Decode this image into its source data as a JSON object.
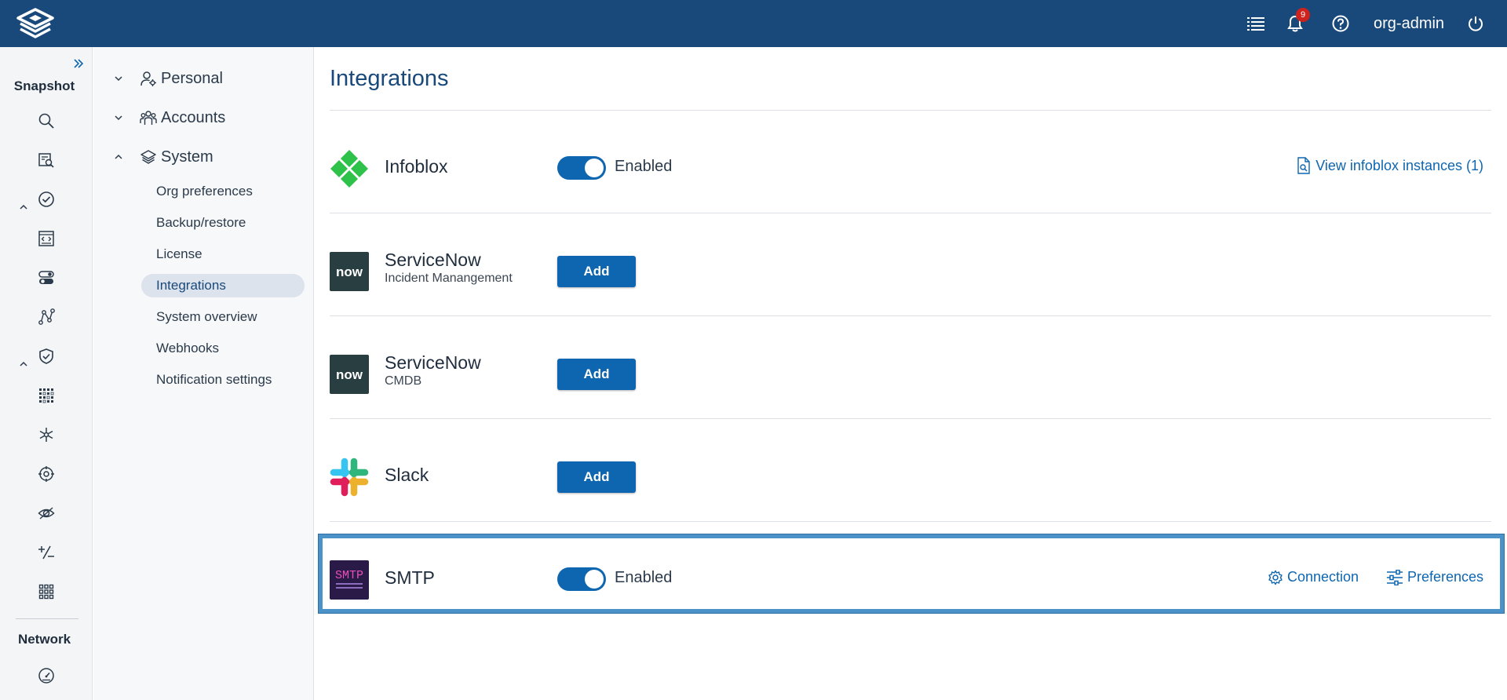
{
  "header": {
    "logo_icon": "stacked-layers-logo",
    "notification_count": "9",
    "user": "org-admin"
  },
  "rail": {
    "sections": [
      {
        "title": "Snapshot"
      },
      {
        "title": "Network"
      }
    ]
  },
  "tree": {
    "groups": [
      {
        "label": "Personal"
      },
      {
        "label": "Accounts"
      },
      {
        "label": "System"
      }
    ],
    "system_items": [
      {
        "label": "Org preferences"
      },
      {
        "label": "Backup/restore"
      },
      {
        "label": "License"
      },
      {
        "label": "Integrations"
      },
      {
        "label": "System overview"
      },
      {
        "label": "Webhooks"
      },
      {
        "label": "Notification settings"
      }
    ]
  },
  "main": {
    "title": "Integrations",
    "integrations": [
      {
        "name": "Infoblox",
        "status": "Enabled",
        "link": "View infoblox instances (1)"
      },
      {
        "name": "ServiceNow",
        "subtitle": "Incident Manangement",
        "action": "Add",
        "logo_text": "now"
      },
      {
        "name": "ServiceNow",
        "subtitle": "CMDB",
        "action": "Add",
        "logo_text": "now"
      },
      {
        "name": "Slack",
        "action": "Add"
      },
      {
        "name": "SMTP",
        "status": "Enabled",
        "logo_text": "SMTP",
        "connection_link": "Connection",
        "preferences_link": "Preferences"
      }
    ]
  },
  "colors": {
    "header_bg": "#19497a",
    "accent": "#0e66b0",
    "selection_frame": "#4a92c8"
  }
}
